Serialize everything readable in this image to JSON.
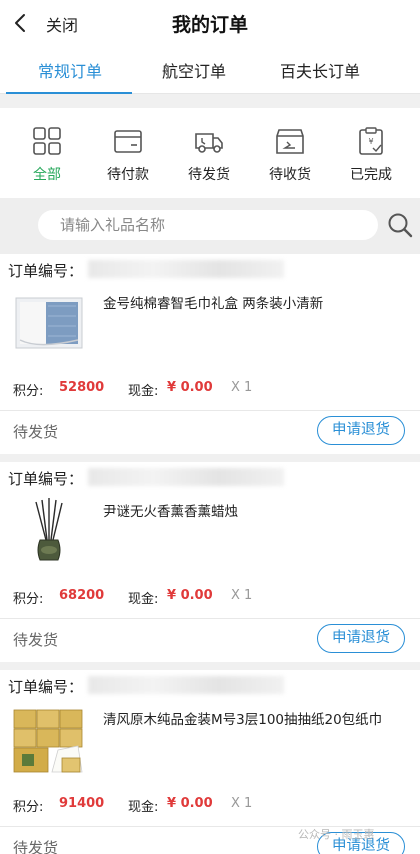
{
  "header": {
    "back_icon": "chevron-left-icon",
    "close_label": "关闭",
    "title": "我的订单"
  },
  "tabs": [
    {
      "label": "常规订单",
      "active": true
    },
    {
      "label": "航空订单",
      "active": false
    },
    {
      "label": "百夫长订单",
      "active": false
    }
  ],
  "status_filters": [
    {
      "label": "全部",
      "icon": "grid-icon",
      "active": true
    },
    {
      "label": "待付款",
      "icon": "wallet-icon",
      "active": false
    },
    {
      "label": "待发货",
      "icon": "delivery-truck-icon",
      "active": false
    },
    {
      "label": "待收货",
      "icon": "package-box-icon",
      "active": false
    },
    {
      "label": "已完成",
      "icon": "clipboard-check-icon",
      "active": false
    }
  ],
  "search": {
    "placeholder": "请输入礼品名称",
    "icon": "search-icon"
  },
  "orders": [
    {
      "order_no_label": "订单编号：",
      "product_name": "金号纯棉睿智毛巾礼盒 两条装小清新",
      "points_label": "积分:",
      "points": "52800",
      "cash_label": "现金:",
      "cash": "¥ 0.00",
      "qty": "X 1",
      "status": "待发货",
      "action_label": "申请退货",
      "thumb": "towel-gift-box"
    },
    {
      "order_no_label": "订单编号：",
      "product_name": "尹谜无火香薰香薰蜡烛",
      "points_label": "积分:",
      "points": "68200",
      "cash_label": "现金:",
      "cash": "¥ 0.00",
      "qty": "X 1",
      "status": "待发货",
      "action_label": "申请退货",
      "thumb": "reed-diffuser"
    },
    {
      "order_no_label": "订单编号：",
      "product_name": "清风原木纯品金装M号3层100抽抽纸20包纸巾",
      "points_label": "积分:",
      "points": "91400",
      "cash_label": "现金:",
      "cash": "¥ 0.00",
      "qty": "X 1",
      "status": "待发货",
      "action_label": "申请退货",
      "thumb": "tissue-packs"
    }
  ],
  "watermark": "公众号 · 雨玉惠",
  "colors": {
    "accent": "#2a8fd6",
    "active_green": "#27a85b",
    "price_red": "#e03a3a"
  }
}
